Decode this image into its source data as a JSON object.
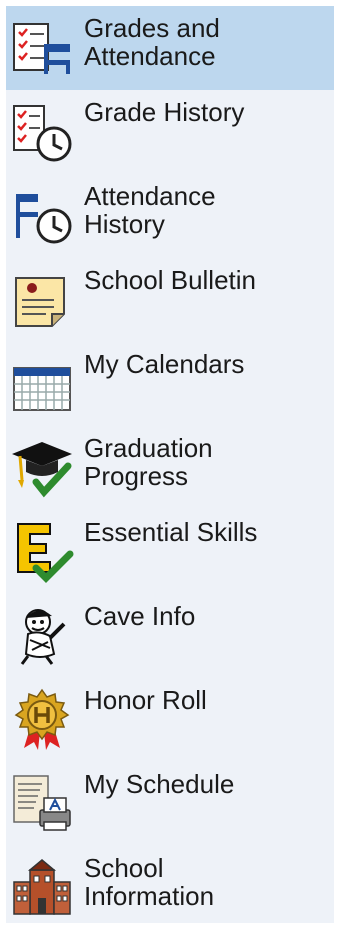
{
  "nav": {
    "items": [
      {
        "label_1": "Grades and",
        "label_2": "Attendance",
        "icon": "grades-attendance-icon",
        "active": true
      },
      {
        "label_1": "Grade History",
        "label_2": "",
        "icon": "grade-history-icon"
      },
      {
        "label_1": "Attendance",
        "label_2": "History",
        "icon": "attendance-history-icon"
      },
      {
        "label_1": "School Bulletin",
        "label_2": "",
        "icon": "school-bulletin-icon"
      },
      {
        "label_1": "My Calendars",
        "label_2": "",
        "icon": "calendar-icon"
      },
      {
        "label_1": "Graduation",
        "label_2": "Progress",
        "icon": "graduation-cap-icon"
      },
      {
        "label_1": "Essential Skills",
        "label_2": "",
        "icon": "essential-skills-icon"
      },
      {
        "label_1": "Cave Info",
        "label_2": "",
        "icon": "caveman-mascot-icon"
      },
      {
        "label_1": "Honor Roll",
        "label_2": "",
        "icon": "honor-roll-medal-icon"
      },
      {
        "label_1": "My Schedule",
        "label_2": "",
        "icon": "schedule-printer-icon"
      },
      {
        "label_1": "School",
        "label_2": "Information",
        "icon": "school-building-icon"
      }
    ]
  },
  "colors": {
    "nav_background": "#eef2f8",
    "active_background": "#bdd7ee",
    "text": "#1a1a1a"
  }
}
